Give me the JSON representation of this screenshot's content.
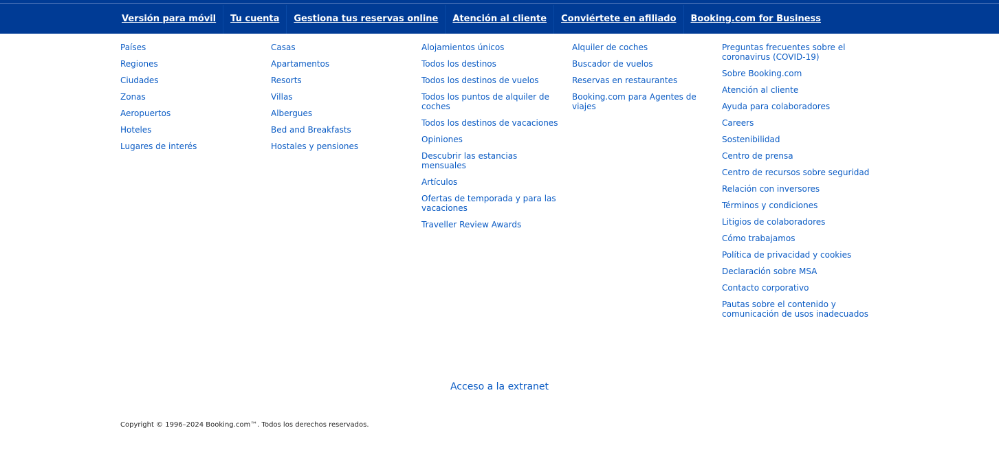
{
  "topnav": {
    "items": [
      "Versión para móvil",
      "Tu cuenta",
      "Gestiona tus reservas online",
      "Atención al cliente",
      "Conviértete en afiliado",
      "Booking.com for Business"
    ]
  },
  "columns": [
    {
      "links": [
        "Países",
        "Regiones",
        "Ciudades",
        "Zonas",
        "Aeropuertos",
        "Hoteles",
        "Lugares de interés"
      ]
    },
    {
      "links": [
        "Casas",
        "Apartamentos",
        "Resorts",
        "Villas",
        "Albergues",
        "Bed and Breakfasts",
        "Hostales y pensiones"
      ]
    },
    {
      "links": [
        "Alojamientos únicos",
        "Todos los destinos",
        "Todos los destinos de vuelos",
        "Todos los puntos de alquiler de coches",
        "Todos los destinos de vacaciones",
        "Opiniones",
        "Descubrir las estancias mensuales",
        "Artículos",
        "Ofertas de temporada y para las vacaciones",
        "Traveller Review Awards"
      ]
    },
    {
      "links": [
        "Alquiler de coches",
        "Buscador de vuelos",
        "Reservas en restaurantes",
        "Booking.com para Agentes de viajes"
      ]
    },
    {
      "links": [
        "Preguntas frecuentes sobre el coronavirus (COVID-19)",
        "Sobre Booking.com",
        "Atención al cliente",
        "Ayuda para colaboradores",
        "Careers",
        "Sostenibilidad",
        "Centro de prensa",
        "Centro de recursos sobre seguridad",
        "Relación con inversores",
        "Términos y condiciones",
        "Litigios de colaboradores",
        "Cómo trabajamos",
        "Política de privacidad y cookies",
        "Declaración sobre MSA",
        "Contacto corporativo",
        "Pautas sobre el contenido y comunicación de usos inadecuados"
      ]
    }
  ],
  "extranet": "Acceso a la extranet",
  "copyright": "Copyright © 1996–2024 Booking.com™. Todos los derechos reservados.",
  "colors": {
    "topbar_bg": "#003b95",
    "link": "#0a5bc4",
    "text": "#262626"
  }
}
